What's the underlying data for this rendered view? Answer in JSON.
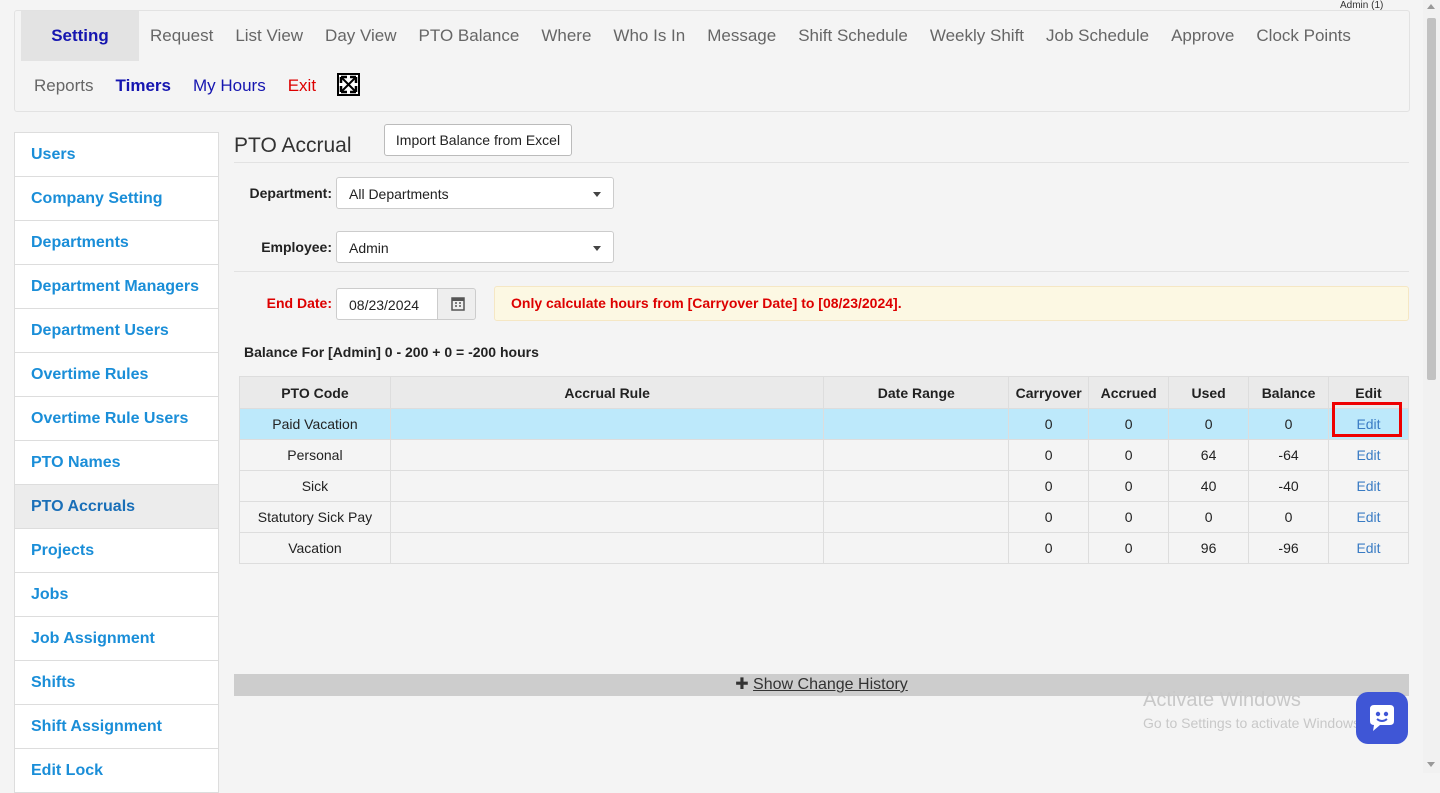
{
  "header": {
    "user_label": "Admin (1)"
  },
  "nav": {
    "row1": [
      "Setting",
      "Request",
      "List View",
      "Day View",
      "PTO Balance",
      "Where",
      "Who Is In",
      "Message",
      "Shift Schedule",
      "Weekly Shift",
      "Job Schedule",
      "Approve",
      "Clock Points"
    ],
    "row2": {
      "reports": "Reports",
      "timers": "Timers",
      "my_hours": "My Hours",
      "exit": "Exit",
      "fullscreen_icon": "fullscreen-icon"
    }
  },
  "sidebar": {
    "items": [
      {
        "label": "Users"
      },
      {
        "label": "Company Setting"
      },
      {
        "label": "Departments"
      },
      {
        "label": "Department Managers"
      },
      {
        "label": "Department Users"
      },
      {
        "label": "Overtime Rules"
      },
      {
        "label": "Overtime Rule Users"
      },
      {
        "label": "PTO Names"
      },
      {
        "label": "PTO Accruals"
      },
      {
        "label": "Projects"
      },
      {
        "label": "Jobs"
      },
      {
        "label": "Job Assignment"
      },
      {
        "label": "Shifts"
      },
      {
        "label": "Shift Assignment"
      },
      {
        "label": "Edit Lock"
      }
    ],
    "active": "PTO Accruals"
  },
  "main": {
    "title": "PTO Accrual",
    "import_button": "Import Balance from Excel",
    "department_label": "Department:",
    "department_value": "All Departments",
    "employee_label": "Employee:",
    "employee_value": "Admin",
    "end_date_label": "End Date:",
    "end_date_value": "08/23/2024",
    "notice": "Only calculate hours from [Carryover Date] to [08/23/2024].",
    "balance_text": "Balance For [Admin] 0 - 200 + 0 = -200 hours",
    "table": {
      "headers": [
        "PTO Code",
        "Accrual Rule",
        "Date Range",
        "Carryover",
        "Accrued",
        "Used",
        "Balance",
        "Edit"
      ],
      "rows": [
        {
          "code": "Paid Vacation",
          "rule": "",
          "range": "",
          "carryover": "0",
          "accrued": "0",
          "used": "0",
          "balance": "0",
          "edit": "Edit"
        },
        {
          "code": "Personal",
          "rule": "",
          "range": "",
          "carryover": "0",
          "accrued": "0",
          "used": "64",
          "balance": "-64",
          "edit": "Edit"
        },
        {
          "code": "Sick",
          "rule": "",
          "range": "",
          "carryover": "0",
          "accrued": "0",
          "used": "40",
          "balance": "-40",
          "edit": "Edit"
        },
        {
          "code": "Statutory Sick Pay",
          "rule": "",
          "range": "",
          "carryover": "0",
          "accrued": "0",
          "used": "0",
          "balance": "0",
          "edit": "Edit"
        },
        {
          "code": "Vacation",
          "rule": "",
          "range": "",
          "carryover": "0",
          "accrued": "0",
          "used": "96",
          "balance": "-96",
          "edit": "Edit"
        }
      ]
    },
    "show_history": "Show Change History"
  },
  "watermark": {
    "line1": "Activate Windows",
    "line2": "Go to Settings to activate Windows."
  },
  "colors": {
    "link_blue": "#1a8ed8",
    "nav_blue": "#1515b0",
    "exit_red": "#dd0000",
    "notice_red": "#dd0000",
    "selected_row": "#bde9fb",
    "chat_button": "#3f56d6"
  }
}
